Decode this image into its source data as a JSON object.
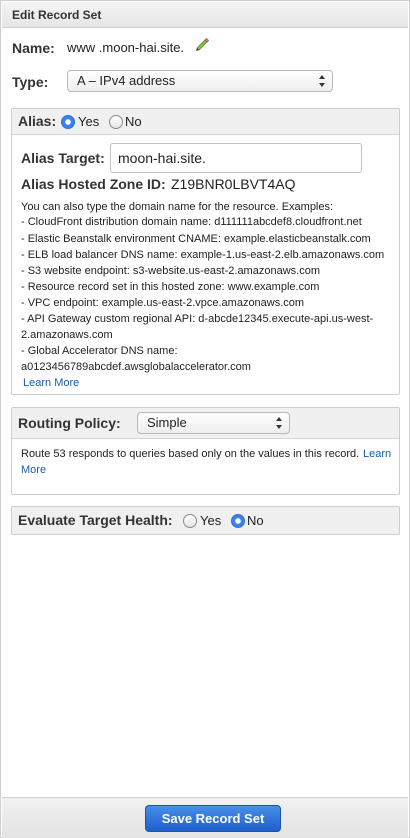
{
  "header": {
    "title": "Edit Record Set"
  },
  "name": {
    "label": "Name:",
    "value": "www .moon-hai.site."
  },
  "type": {
    "label": "Type:",
    "selected": "A – IPv4 address"
  },
  "alias": {
    "label": "Alias:",
    "yes_label": "Yes",
    "no_label": "No",
    "selected": "Yes",
    "target_label": "Alias Target:",
    "target_value": "moon-hai.site.",
    "zone_label": "Alias Hosted Zone ID:",
    "zone_value": "Z19BNR0LBVT4AQ",
    "help_lines": [
      "You can also type the domain name for the resource. Examples:",
      "- CloudFront distribution domain name: d111111abcdef8.cloudfront.net",
      "- Elastic Beanstalk environment CNAME: example.elasticbeanstalk.com",
      "- ELB load balancer DNS name: example-1.us-east-2.elb.amazonaws.com",
      "- S3 website endpoint: s3-website.us-east-2.amazonaws.com",
      "- Resource record set in this hosted zone: www.example.com",
      "- VPC endpoint: example.us-east-2.vpce.amazonaws.com",
      "- API Gateway custom regional API: d-abcde12345.execute-api.us-west-",
      "2.amazonaws.com",
      "- Global Accelerator DNS name:",
      "a0123456789abcdef.awsglobalaccelerator.com"
    ],
    "learn_more": "Learn More"
  },
  "routing": {
    "label": "Routing Policy:",
    "selected": "Simple",
    "description_1": "Route 53 responds to queries based only on the values in this record.",
    "learn_1": "Learn",
    "learn_2": "More"
  },
  "health": {
    "label": "Evaluate Target Health:",
    "yes_label": "Yes",
    "no_label": "No",
    "selected": "No"
  },
  "footer": {
    "save_label": "Save Record Set"
  },
  "colors": {
    "accent": "#1d5fcc",
    "link": "#1a5ea8"
  },
  "icons": [
    "pencil-icon",
    "select-arrows-icon"
  ]
}
